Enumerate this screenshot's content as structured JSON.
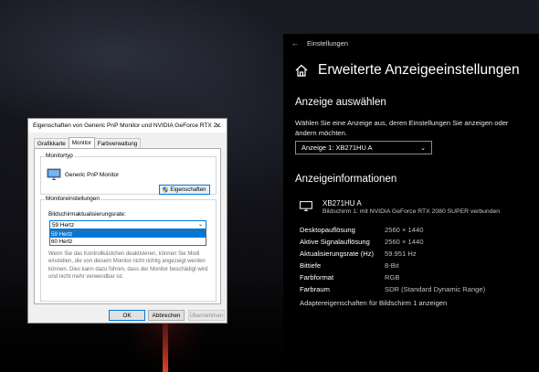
{
  "settings": {
    "window_title": "Einstellungen",
    "page_title": "Erweiterte Anzeigeeinstellungen",
    "select_display": {
      "heading": "Anzeige auswählen",
      "description": "Wählen Sie eine Anzeige aus, deren Einstellungen Sie anzeigen oder ändern möchten.",
      "selected": "Anzeige 1: XB271HU A"
    },
    "display_info": {
      "heading": "Anzeigeinformationen",
      "monitor_name": "XB271HU A",
      "monitor_sub": "Bildschirm 1: mit NVIDIA GeForce RTX 2080 SUPER verbunden",
      "rows": [
        {
          "key": "Desktopauflösung",
          "value": "2560 × 1440"
        },
        {
          "key": "Aktive Signalauflösung",
          "value": "2560 × 1440"
        },
        {
          "key": "Aktualisierungsrate (Hz)",
          "value": "59.951 Hz"
        },
        {
          "key": "Bittiefe",
          "value": "8-Bit"
        },
        {
          "key": "Farbformat",
          "value": "RGB"
        },
        {
          "key": "Farbraum",
          "value": "SDR (Standard Dynamic Range)"
        }
      ],
      "adapter_link": "Adaptereigenschaften für Bildschirm 1 anzeigen"
    }
  },
  "dialog": {
    "title": "Eigenschaften von Generic PnP Monitor und NVIDIA GeForce RTX 2...",
    "close": "✕",
    "tabs": [
      "Grafikkarte",
      "Monitor",
      "Farbverwaltung"
    ],
    "monitor_type": {
      "label": "Monitortyp",
      "name": "Generic PnP Monitor",
      "properties_button": "Eigenschaften"
    },
    "monitor_settings": {
      "label": "Monitoreinstellungen",
      "rate_label": "Bildschirmaktualisierungsrate:",
      "rate_selected": "59 Hertz",
      "rate_options": [
        "59 Hertz",
        "60 Hertz"
      ],
      "warning": "Wenn Sie das Kontrollkästchen deaktivieren, können Sie Modi einstellen, die von diesem Monitor nicht richtig angezeigt werden können. Dies kann dazu führen, dass der Monitor beschädigt wird und nicht mehr verwendbar ist."
    },
    "buttons": {
      "ok": "OK",
      "cancel": "Abbrechen",
      "apply": "Übernehmen"
    }
  }
}
